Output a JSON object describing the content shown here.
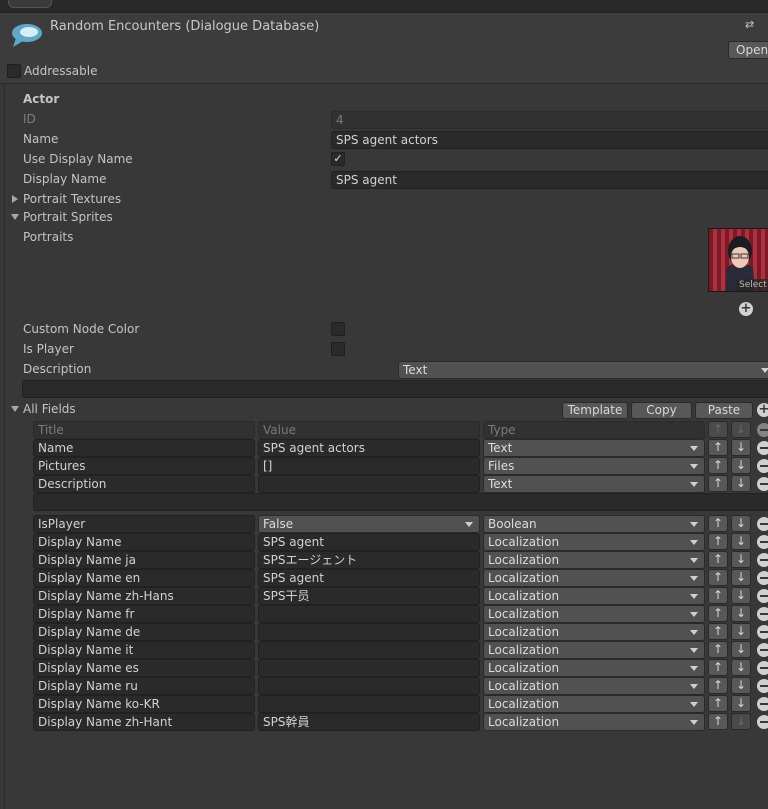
{
  "header": {
    "title": "Random Encounters (Dialogue Database)",
    "open_label": "Open",
    "addressable_label": "Addressable"
  },
  "actor": {
    "section_label": "Actor",
    "id_label": "ID",
    "id_value": "4",
    "name_label": "Name",
    "name_value": "SPS agent actors",
    "use_display_name_label": "Use Display Name",
    "display_name_label": "Display Name",
    "display_name_value": "SPS agent",
    "portrait_textures_label": "Portrait Textures",
    "portrait_sprites_label": "Portrait Sprites",
    "portraits_label": "Portraits",
    "portrait_select_label": "Select",
    "custom_node_color_label": "Custom Node Color",
    "is_player_label": "Is Player",
    "description_label": "Description",
    "description_type": "Text"
  },
  "all_fields": {
    "label": "All Fields",
    "template_label": "Template",
    "copy_label": "Copy",
    "paste_label": "Paste",
    "headers": {
      "title": "Title",
      "value": "Value",
      "type": "Type"
    },
    "rows": [
      {
        "title": "Name",
        "value": "SPS agent actors",
        "type": "Text"
      },
      {
        "title": "Pictures",
        "value": "[]",
        "type": "Files"
      },
      {
        "title": "Description",
        "value": "",
        "type": "Text"
      },
      {
        "title": "IsPlayer",
        "value": "False",
        "type": "Boolean"
      },
      {
        "title": "Display Name",
        "value": "SPS agent",
        "type": "Localization"
      },
      {
        "title": "Display Name ja",
        "value": "SPSエージェント",
        "type": "Localization"
      },
      {
        "title": "Display Name en",
        "value": "SPS agent",
        "type": "Localization"
      },
      {
        "title": "Display Name zh-Hans",
        "value": "SPS干员",
        "type": "Localization"
      },
      {
        "title": "Display Name fr",
        "value": "",
        "type": "Localization"
      },
      {
        "title": "Display Name de",
        "value": "",
        "type": "Localization"
      },
      {
        "title": "Display Name it",
        "value": "",
        "type": "Localization"
      },
      {
        "title": "Display Name es",
        "value": "",
        "type": "Localization"
      },
      {
        "title": "Display Name ru",
        "value": "",
        "type": "Localization"
      },
      {
        "title": "Display Name ko-KR",
        "value": "",
        "type": "Localization"
      },
      {
        "title": "Display Name zh-Hant",
        "value": "SPS幹員",
        "type": "Localization"
      }
    ]
  }
}
